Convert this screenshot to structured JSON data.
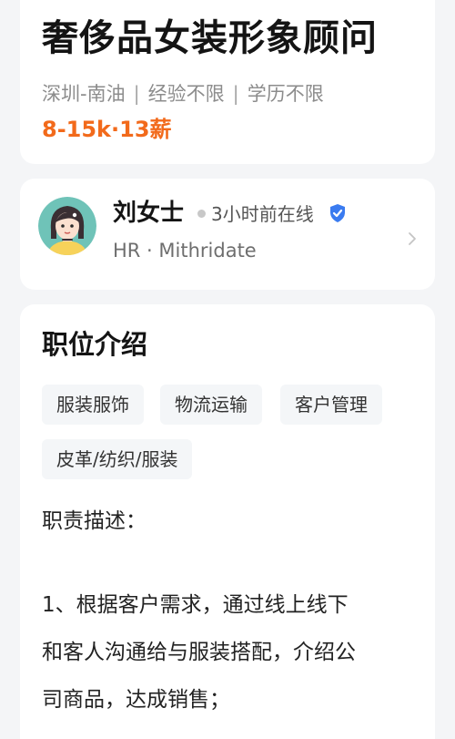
{
  "job": {
    "title": "奢侈品女装形象顾问",
    "location": "深圳-南油",
    "experience": "经验不限",
    "education": "学历不限",
    "separator": "|",
    "salary": "8-15k·13薪",
    "accent_color": "#f26a1b"
  },
  "recruiter": {
    "name": "刘女士",
    "online_status": "3小时前在线",
    "company_line": "HR · Mithridate",
    "verified_icon": "verified-check-icon",
    "verified_color": "#3a7bf0"
  },
  "description": {
    "section_title": "职位介绍",
    "tags": [
      "服装服饰",
      "物流运输",
      "客户管理",
      "皮革/纺织/服装"
    ],
    "heading": "职责描述：",
    "lines": [
      "1、根据客户需求，通过线上线下",
      "和客人沟通给与服装搭配，介绍公",
      "司商品，达成销售；"
    ]
  }
}
